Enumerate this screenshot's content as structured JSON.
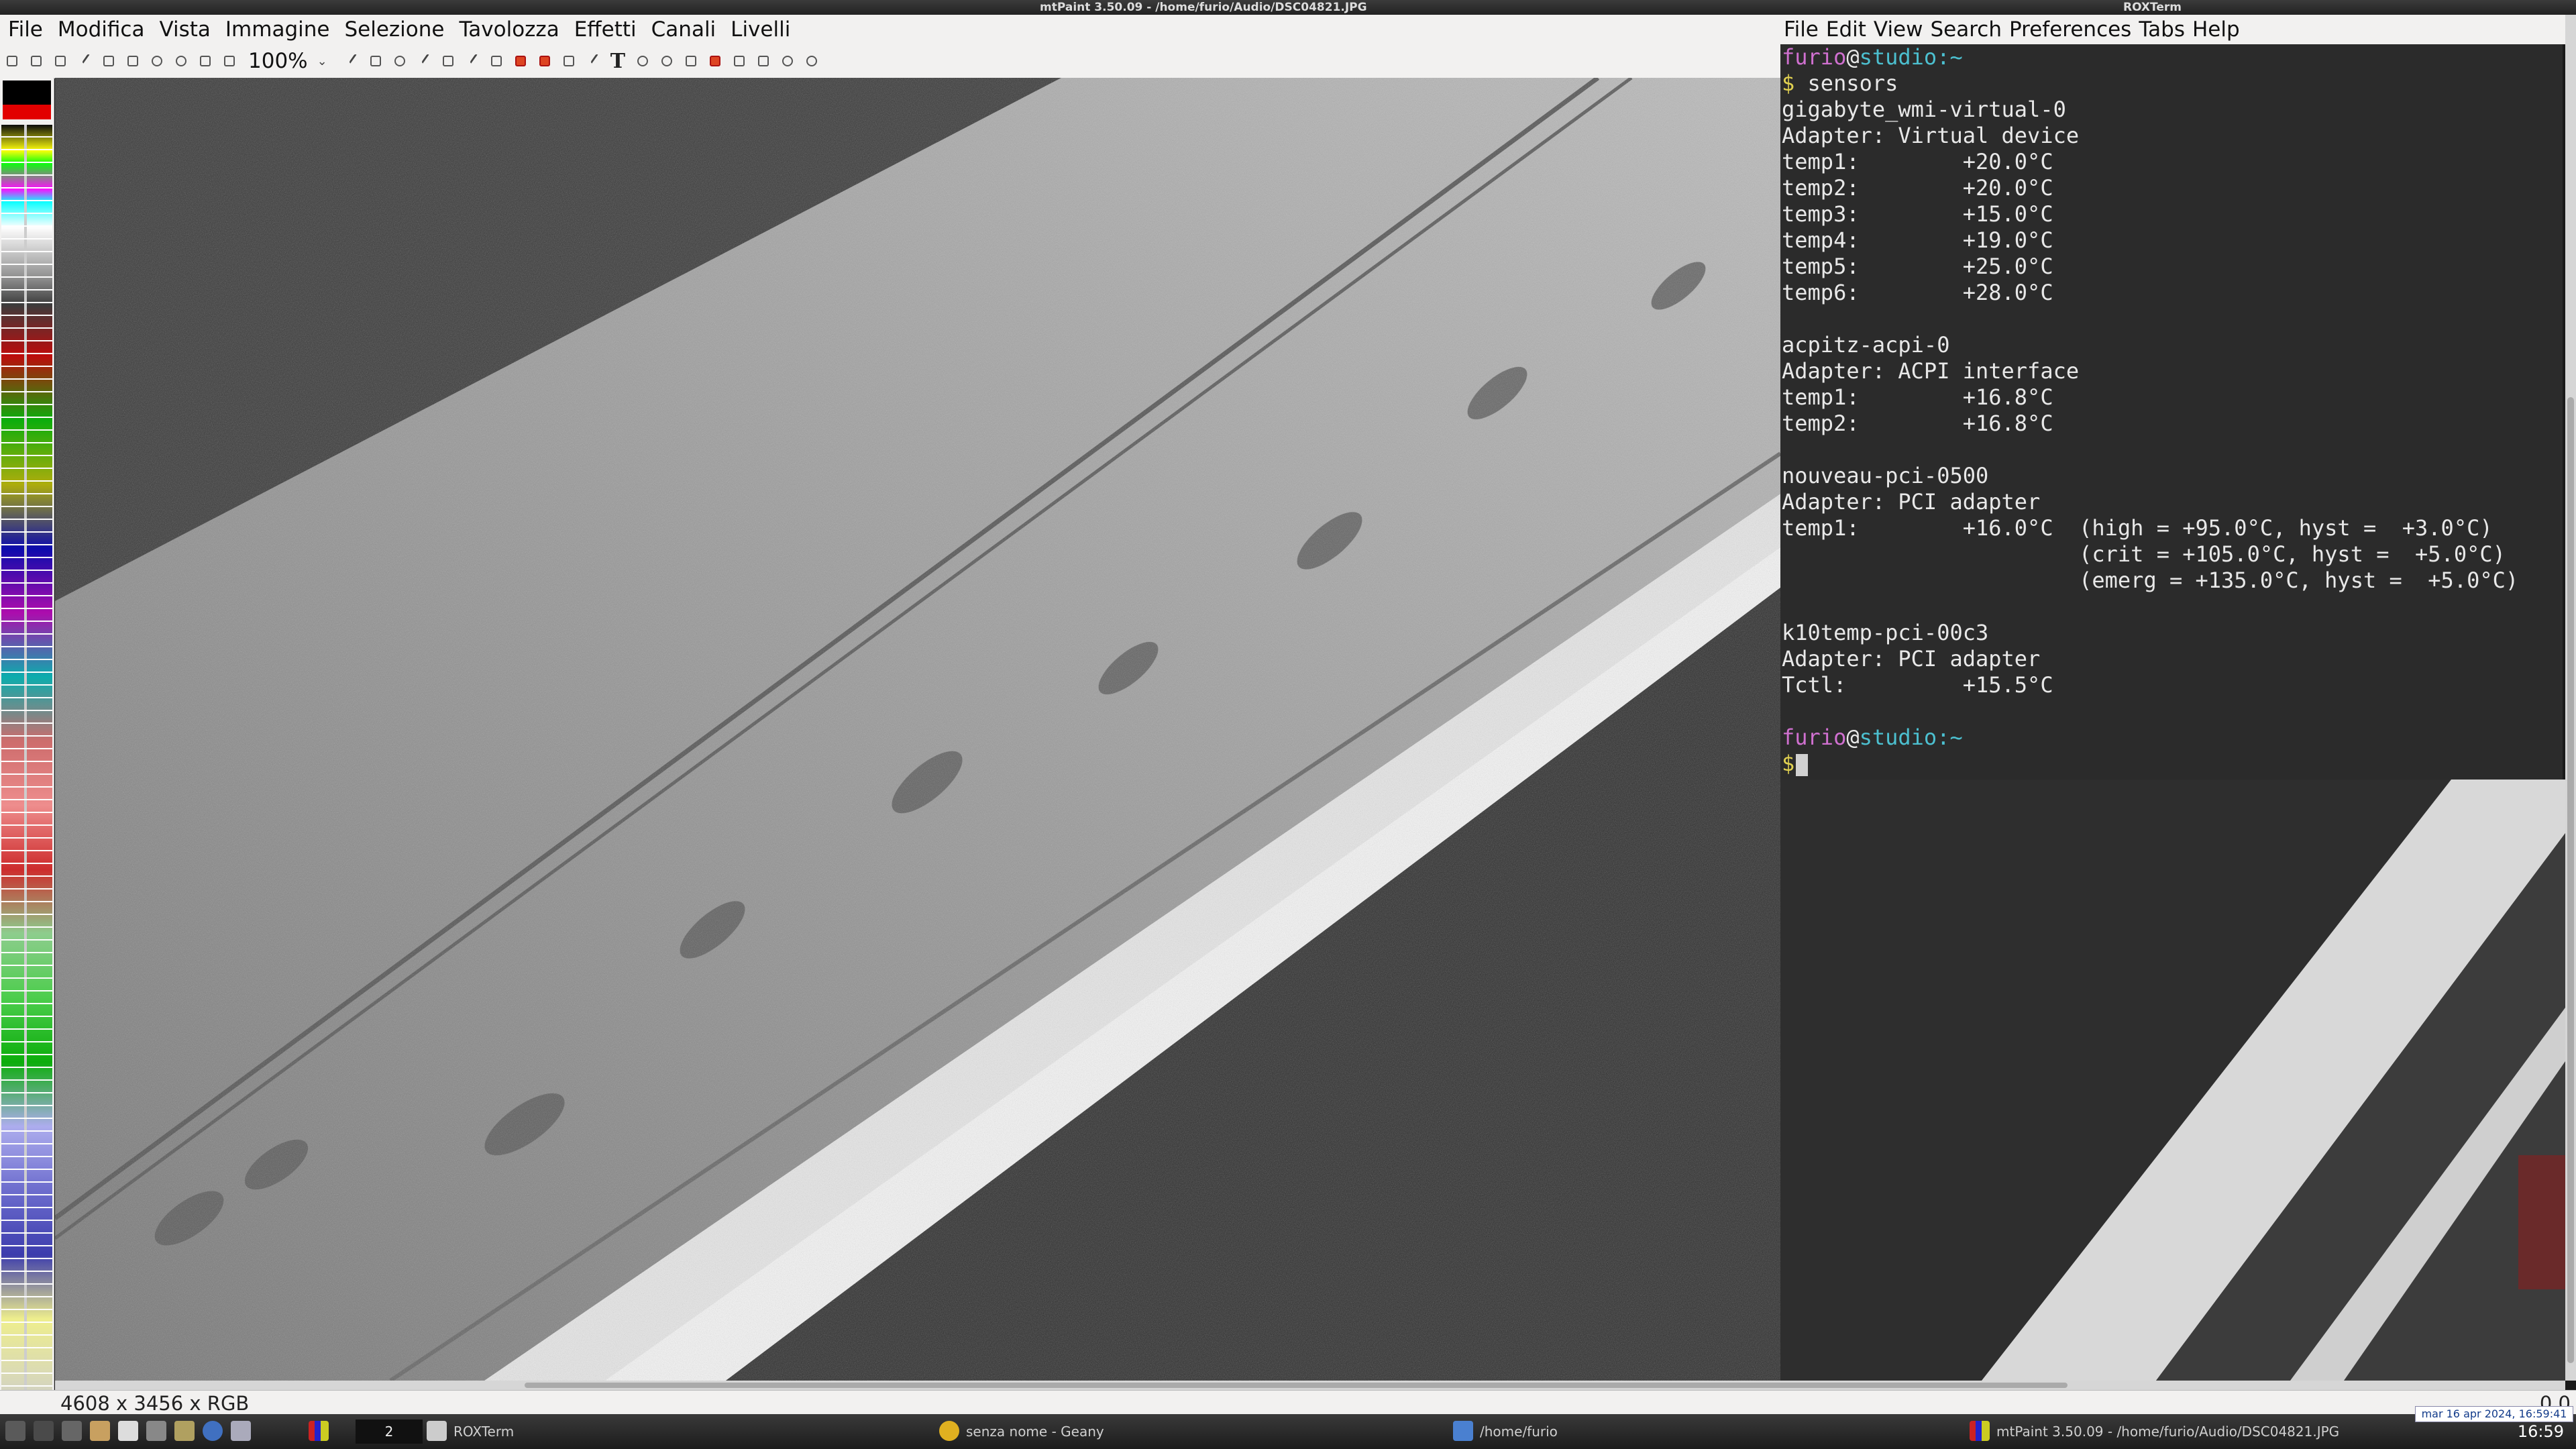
{
  "mtpaint": {
    "title": "mtPaint 3.50.09 - /home/furio/Audio/DSC04821.JPG",
    "menu": [
      "File",
      "Modifica",
      "Vista",
      "Immagine",
      "Selezione",
      "Tavolozza",
      "Effetti",
      "Canali",
      "Livelli"
    ],
    "zoom": "100%",
    "status_size": "4608 x 3456 x RGB",
    "status_coord": "0,0"
  },
  "roxterm": {
    "title": "ROXTerm",
    "menu": [
      "File",
      "Edit",
      "View",
      "Search",
      "Preferences",
      "Tabs",
      "Help"
    ],
    "prompt_user": "furio",
    "prompt_at": "@",
    "prompt_host": "studio",
    "prompt_path": ":~",
    "prompt_symbol": "$",
    "command": " sensors",
    "output_lines": [
      "gigabyte_wmi-virtual-0",
      "Adapter: Virtual device",
      "temp1:        +20.0°C",
      "temp2:        +20.0°C",
      "temp3:        +15.0°C",
      "temp4:        +19.0°C",
      "temp5:        +25.0°C",
      "temp6:        +28.0°C",
      "",
      "acpitz-acpi-0",
      "Adapter: ACPI interface",
      "temp1:        +16.8°C",
      "temp2:        +16.8°C",
      "",
      "nouveau-pci-0500",
      "Adapter: PCI adapter",
      "temp1:        +16.0°C  (high = +95.0°C, hyst =  +3.0°C)",
      "                       (crit = +105.0°C, hyst =  +5.0°C)",
      "                       (emerg = +135.0°C, hyst =  +5.0°C)",
      "",
      "k10temp-pci-00c3",
      "Adapter: PCI adapter",
      "Tctl:         +15.5°C",
      ""
    ]
  },
  "taskbar": {
    "workspace": "2",
    "tasks": [
      "ROXTerm",
      "senza nome - Geany",
      "/home/furio",
      "mtPaint 3.50.09 - /home/furio/Audio/DSC04821.JPG"
    ],
    "clock_tooltip": "mar 16 apr 2024, 16:59:41",
    "time": "16:59"
  },
  "colors": {
    "terminal_bg": "#2b2b2b",
    "prompt_user": "#d070d0",
    "prompt_host": "#4cc0d0",
    "prompt_symbol": "#e0d050",
    "palette_primary": "#000000",
    "palette_secondary": "#e20000"
  }
}
